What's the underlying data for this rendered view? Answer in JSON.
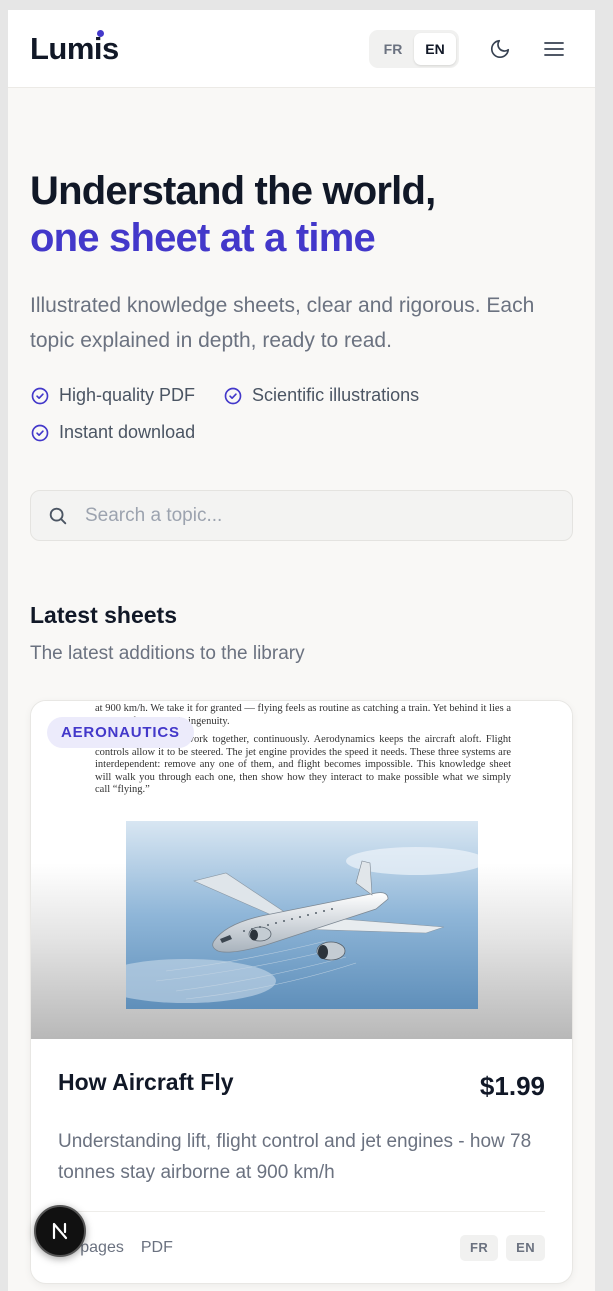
{
  "header": {
    "logo": "Lumis",
    "lang_options": [
      "FR",
      "EN"
    ],
    "active_lang": "EN"
  },
  "hero": {
    "title_line1": "Understand the world,",
    "title_line2": "one sheet at a time",
    "subtitle": "Illustrated knowledge sheets, clear and rigorous. Each topic explained in depth, ready to read.",
    "features": [
      "High-quality PDF",
      "Scientific illustrations",
      "Instant download"
    ]
  },
  "search": {
    "placeholder": "Search a topic..."
  },
  "latest": {
    "title": "Latest sheets",
    "subtitle": "The latest additions to the library"
  },
  "card": {
    "category": "AERONAUTICS",
    "preview_text": [
      "at 900 km/h. We take it for granted — flying feels as routine as catching a train. Yet behind it lies a system of remarkable ingenuity.",
      "Three systems must work together, continuously. Aerodynamics keeps the aircraft aloft. Flight controls allow it to be steered. The jet engine provides the speed it needs. These three systems are interdependent: remove any one of them, and flight becomes impossible. This knowledge sheet will walk you through each one, then show how they interact to make possible what we simply call “flying.”"
    ],
    "title": "How Aircraft Fly",
    "price": "$1.99",
    "description": "Understanding lift, flight control and jet engines - how 78 tonnes stay airborne at 900 km/h",
    "pages": "15 pages",
    "format": "PDF",
    "languages": [
      "FR",
      "EN"
    ]
  },
  "colors": {
    "accent": "#4338ca",
    "text": "#111827",
    "muted": "#6b7280",
    "background": "#f9f8f6"
  },
  "icons": {
    "theme_toggle": "moon-icon",
    "menu": "hamburger-menu-icon",
    "search": "search-icon",
    "feature_check": "check-circle-icon",
    "floating": "nextjs-logo-icon"
  }
}
